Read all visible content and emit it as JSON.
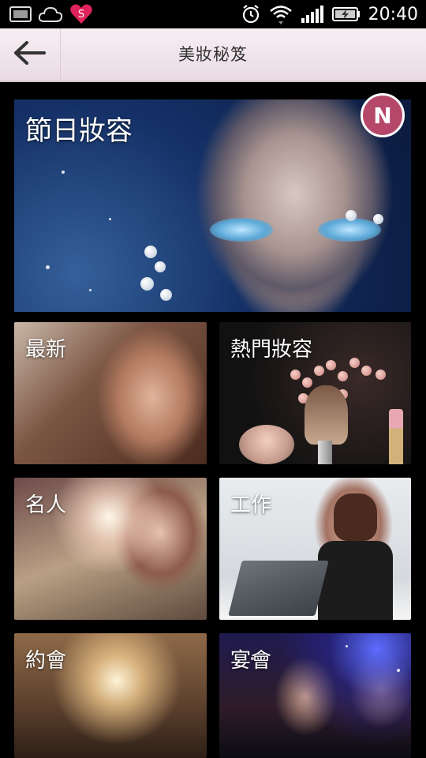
{
  "status_bar": {
    "time": "20:40",
    "left_icons": [
      "image-icon",
      "cloud-icon",
      "heart-s-icon"
    ],
    "right_icons": [
      "alarm-icon",
      "wifi-icon",
      "signal-icon",
      "battery-icon"
    ]
  },
  "header": {
    "title": "美妝秘笈",
    "back_icon": "arrow-left-icon",
    "background": "#f3e9ef"
  },
  "featured": {
    "label": "節日妝容",
    "badge": "N",
    "badge_color": "#b5486a"
  },
  "tiles": [
    {
      "label": "最新"
    },
    {
      "label": "熱門妝容"
    },
    {
      "label": "名人"
    },
    {
      "label": "工作"
    },
    {
      "label": "約會"
    },
    {
      "label": "宴會"
    }
  ]
}
